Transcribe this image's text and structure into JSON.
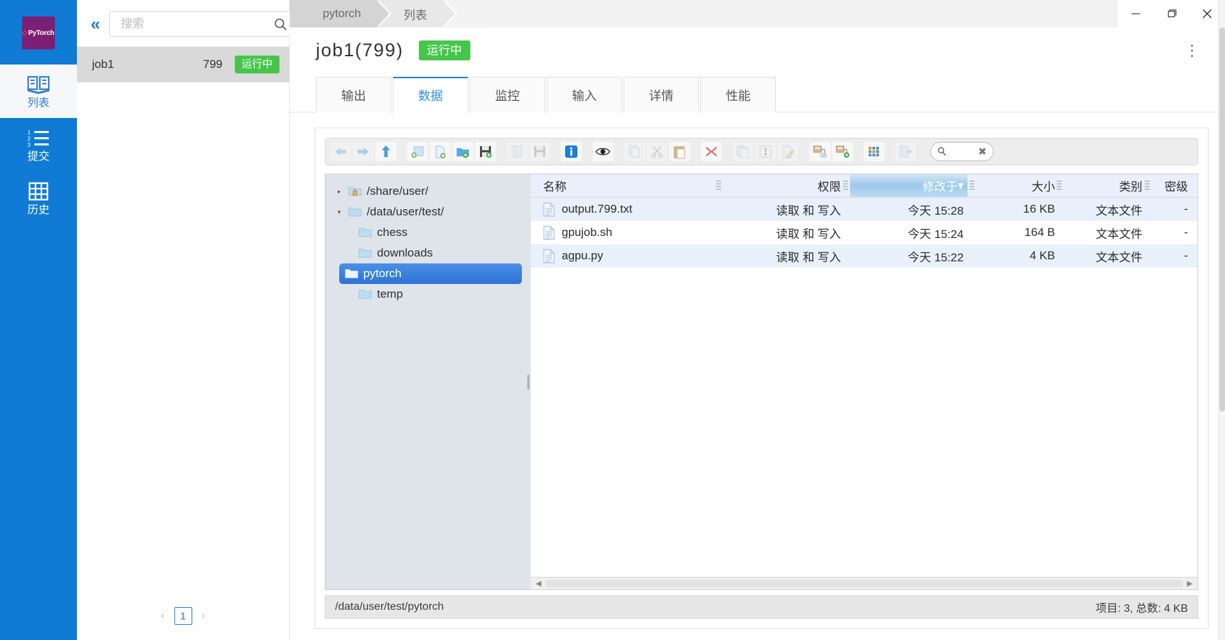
{
  "rail": {
    "logo_text": "PyTorch",
    "items": [
      {
        "label": "列表",
        "icon": "book-icon",
        "active": true
      },
      {
        "label": "提交",
        "icon": "ordered-list-icon",
        "active": false
      },
      {
        "label": "历史",
        "icon": "grid-icon",
        "active": false
      }
    ]
  },
  "joblist": {
    "collapse_icon": "«",
    "search_placeholder": "搜索",
    "search_value": "",
    "search_icon": "search-icon",
    "rows": [
      {
        "name": "job1",
        "id": "799",
        "status": "运行中"
      }
    ],
    "pager": {
      "prev": "‹",
      "page": "1",
      "next": "›"
    }
  },
  "titlebar": {
    "breadcrumb": [
      "pytorch",
      "列表"
    ],
    "window_buttons": [
      "minimize-icon",
      "restore-icon",
      "close-icon"
    ]
  },
  "job": {
    "title": "job1(799)",
    "status": "运行中",
    "menu_icon": "kebab-menu-icon"
  },
  "tabs": [
    {
      "label": "输出",
      "active": false
    },
    {
      "label": "数据",
      "active": true
    },
    {
      "label": "监控",
      "active": false
    },
    {
      "label": "输入",
      "active": false
    },
    {
      "label": "详情",
      "active": false
    },
    {
      "label": "性能",
      "active": false
    }
  ],
  "filemanager": {
    "toolbar_groups": [
      [
        "back-icon",
        "forward-icon",
        "up-icon"
      ],
      [
        "new-window-icon",
        "new-file-icon",
        "new-folder-icon",
        "save-icon"
      ],
      [
        "open-book-icon",
        "save-disk-icon"
      ],
      [
        "info-icon"
      ],
      [
        "preview-eye-icon"
      ],
      [
        "copy-icon",
        "cut-scissors-icon",
        "paste-icon"
      ],
      [
        "delete-x-icon"
      ],
      [
        "duplicate-icon",
        "select-all-icon",
        "rename-edit-icon"
      ],
      [
        "compress-icon",
        "extract-icon"
      ],
      [
        "color-grid-icon"
      ],
      [
        "export-icon"
      ]
    ],
    "search_placeholder": "",
    "search_value": "",
    "search_icon": "magnifier-icon",
    "search_clear_icon": "clear-x-icon",
    "tree": [
      {
        "label": "/share/user/",
        "level": 0,
        "twist": "▸",
        "icon": "folder-lock-icon",
        "selected": false
      },
      {
        "label": "/data/user/test/",
        "level": 0,
        "twist": "▾",
        "icon": "folder-icon",
        "selected": false
      },
      {
        "label": "chess",
        "level": 1,
        "twist": "",
        "icon": "folder-icon",
        "selected": false
      },
      {
        "label": "downloads",
        "level": 1,
        "twist": "",
        "icon": "folder-icon",
        "selected": false
      },
      {
        "label": "pytorch",
        "level": 1,
        "twist": "",
        "icon": "folder-open-icon",
        "selected": true
      },
      {
        "label": "temp",
        "level": 1,
        "twist": "",
        "icon": "folder-icon",
        "selected": false
      }
    ],
    "columns": [
      {
        "key": "name",
        "label": "名称",
        "sorted": false
      },
      {
        "key": "perm",
        "label": "权限",
        "sorted": false
      },
      {
        "key": "modified",
        "label": "修改于",
        "sorted": true,
        "sort_arrow": "▾"
      },
      {
        "key": "size",
        "label": "大小",
        "sorted": false
      },
      {
        "key": "type",
        "label": "类别",
        "sorted": false
      },
      {
        "key": "classification",
        "label": "密级",
        "sorted": false
      }
    ],
    "files": [
      {
        "name": "output.799.txt",
        "perm": "读取 和 写入",
        "modified": "今天 15:28",
        "size": "16 KB",
        "type": "文本文件",
        "classification": "-",
        "icon": "text-file-icon"
      },
      {
        "name": "gpujob.sh",
        "perm": "读取 和 写入",
        "modified": "今天 15:24",
        "size": "164 B",
        "type": "文本文件",
        "classification": "-",
        "icon": "text-file-icon"
      },
      {
        "name": "agpu.py",
        "perm": "读取 和 写入",
        "modified": "今天 15:22",
        "size": "4 KB",
        "type": "文本文件",
        "classification": "-",
        "icon": "text-file-icon"
      }
    ],
    "status_path": "/data/user/test/pytorch",
    "status_summary": "项目: 3, 总数: 4 KB"
  },
  "colors": {
    "rail_blue": "#0f7bd4",
    "accent_blue": "#1a7ad4",
    "status_green": "#45c64b",
    "tree_bg": "#dfe4ea",
    "row_alt": "#eaf0fb",
    "selection_blue": "#2f72d6"
  }
}
